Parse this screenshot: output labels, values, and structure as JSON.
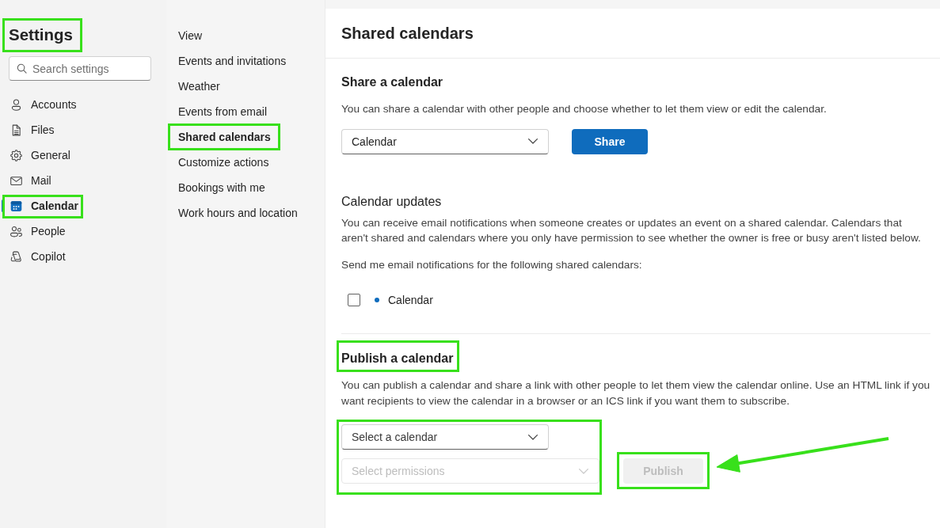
{
  "sidebar": {
    "title": {
      "text": "Settings",
      "highlighted": true
    },
    "search": {
      "placeholder": "Search settings"
    },
    "items": [
      {
        "label": "Accounts",
        "selected": false,
        "highlighted": false
      },
      {
        "label": "Files",
        "selected": false,
        "highlighted": false
      },
      {
        "label": "General",
        "selected": false,
        "highlighted": false
      },
      {
        "label": "Mail",
        "selected": false,
        "highlighted": false
      },
      {
        "label": "Calendar",
        "selected": true,
        "highlighted": true
      },
      {
        "label": "People",
        "selected": false,
        "highlighted": false
      },
      {
        "label": "Copilot",
        "selected": false,
        "highlighted": false
      }
    ]
  },
  "subnav": {
    "items": [
      {
        "label": "View",
        "selected": false,
        "highlighted": false
      },
      {
        "label": "Events and invitations",
        "selected": false,
        "highlighted": false
      },
      {
        "label": "Weather",
        "selected": false,
        "highlighted": false
      },
      {
        "label": "Events from email",
        "selected": false,
        "highlighted": false
      },
      {
        "label": "Shared calendars",
        "selected": true,
        "highlighted": true
      },
      {
        "label": "Customize actions",
        "selected": false,
        "highlighted": false
      },
      {
        "label": "Bookings with me",
        "selected": false,
        "highlighted": false
      },
      {
        "label": "Work hours and location",
        "selected": false,
        "highlighted": false
      }
    ]
  },
  "page": {
    "title": "Shared calendars",
    "share_section": {
      "heading": "Share a calendar",
      "description": "You can share a calendar with other people and choose whether to let them view or edit the calendar.",
      "calendar_dropdown": {
        "value": "Calendar",
        "disabled": false
      },
      "share_button": {
        "label": "Share",
        "disabled": false
      }
    },
    "updates_section": {
      "heading": "Calendar updates",
      "description": "You can receive email notifications when someone creates or updates an event on a shared calendar. Calendars that aren't shared and calendars where you only have permission to see whether the owner is free or busy aren't listed below.",
      "prompt": "Send me email notifications for the following shared calendars:",
      "calendars": [
        {
          "name": "Calendar",
          "checked": false,
          "color": "#0f6cbd"
        }
      ]
    },
    "publish_section": {
      "heading": "Publish a calendar",
      "heading_highlighted": true,
      "description": "You can publish a calendar and share a link with other people to let them view the calendar online. Use an HTML link if you want recipients to view the calendar in a browser or an ICS link if you want them to subscribe.",
      "dropdowns_highlighted": true,
      "calendar_dropdown": {
        "placeholder": "Select a calendar",
        "disabled": false
      },
      "permissions_dropdown": {
        "placeholder": "Select permissions",
        "disabled": true
      },
      "publish_button": {
        "label": "Publish",
        "disabled": true,
        "highlighted": true,
        "pointed_at": true
      }
    }
  }
}
